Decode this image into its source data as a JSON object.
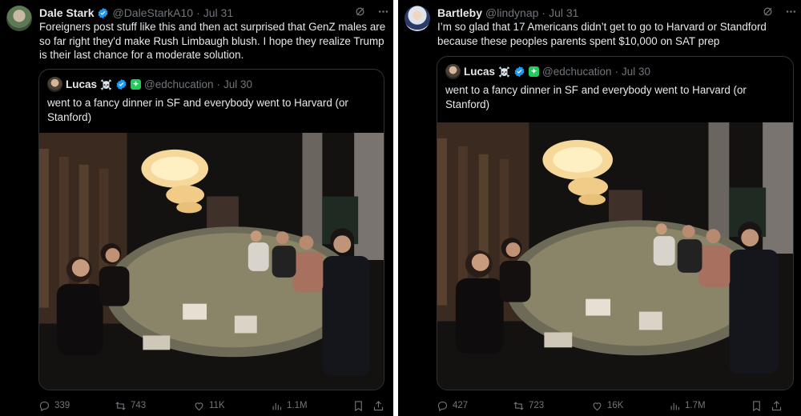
{
  "left_tweet": {
    "author_name": "Dale Stark",
    "handle": "@DaleStarkA10",
    "separator": "·",
    "date": "Jul 31",
    "text": "Foreigners post stuff like this and then act surprised that GenZ males are so far right they'd make Rush Limbaugh blush.  I hope they realize Trump is their last chance for a moderate solution.",
    "quote": {
      "author_name": "Lucas",
      "skull": "☠️",
      "handle": "@edchucation",
      "separator": "·",
      "date": "Jul 30",
      "text": "went to a fancy dinner in SF and everybody went to Harvard (or Stanford)"
    },
    "stats": {
      "replies": "339",
      "retweets": "743",
      "likes": "11K",
      "views": "1.1M"
    }
  },
  "right_tweet": {
    "author_name": "Bartleby",
    "handle": "@lindynap",
    "separator": "·",
    "date": "Jul 31",
    "text": "I’m so glad that 17 Americans didn’t get to go to Harvard or Standford because these peoples parents spent $10,000 on SAT prep",
    "quote": {
      "author_name": "Lucas",
      "skull": "☠️",
      "handle": "@edchucation",
      "separator": "·",
      "date": "Jul 30",
      "text": "went to a fancy dinner in SF and everybody went to Harvard (or Stanford)"
    },
    "stats": {
      "replies": "427",
      "retweets": "723",
      "likes": "16K",
      "views": "1.7M"
    }
  },
  "icons": {
    "verified": "verified-badge-icon",
    "grok": "grok-icon",
    "more": "more-icon",
    "reply": "reply-icon",
    "retweet": "retweet-icon",
    "like": "like-icon",
    "views": "views-icon",
    "bookmark": "bookmark-icon",
    "share": "share-icon"
  },
  "colors": {
    "background": "#000000",
    "text": "#e7e9ea",
    "muted": "#71767b",
    "verified": "#1d9bf0",
    "border": "#2f3336"
  }
}
